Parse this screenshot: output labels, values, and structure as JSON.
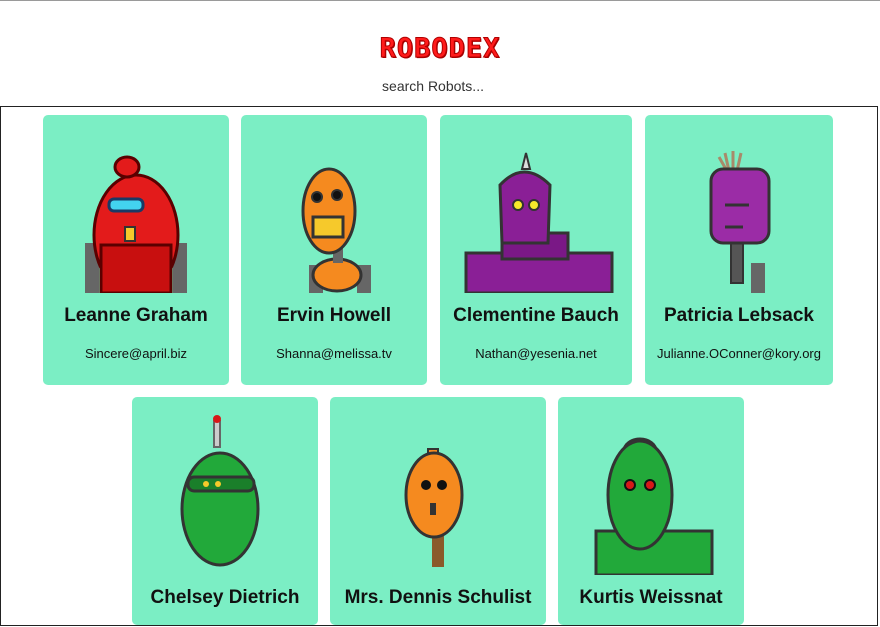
{
  "app": {
    "logo_text": "ROBODEX",
    "logo_color": "#ff1b1b"
  },
  "search": {
    "placeholder": "search Robots..."
  },
  "card_color": "#7beec4",
  "robots": [
    {
      "name": "Leanne Graham",
      "email": "Sincere@april.biz",
      "robot_color": "#e31b1b"
    },
    {
      "name": "Ervin Howell",
      "email": "Shanna@melissa.tv",
      "robot_color": "#f58a1f"
    },
    {
      "name": "Clementine Bauch",
      "email": "Nathan@yesenia.net",
      "robot_color": "#8a1f96"
    },
    {
      "name": "Patricia Lebsack",
      "email": "Julianne.OConner@kory.org",
      "robot_color": "#9b2ca6"
    },
    {
      "name": "Chelsey Dietrich",
      "email": "",
      "robot_color": "#22a93a"
    },
    {
      "name": "Mrs. Dennis Schulist",
      "email": "",
      "robot_color": "#f58a1f"
    },
    {
      "name": "Kurtis Weissnat",
      "email": "",
      "robot_color": "#22a93a"
    }
  ]
}
